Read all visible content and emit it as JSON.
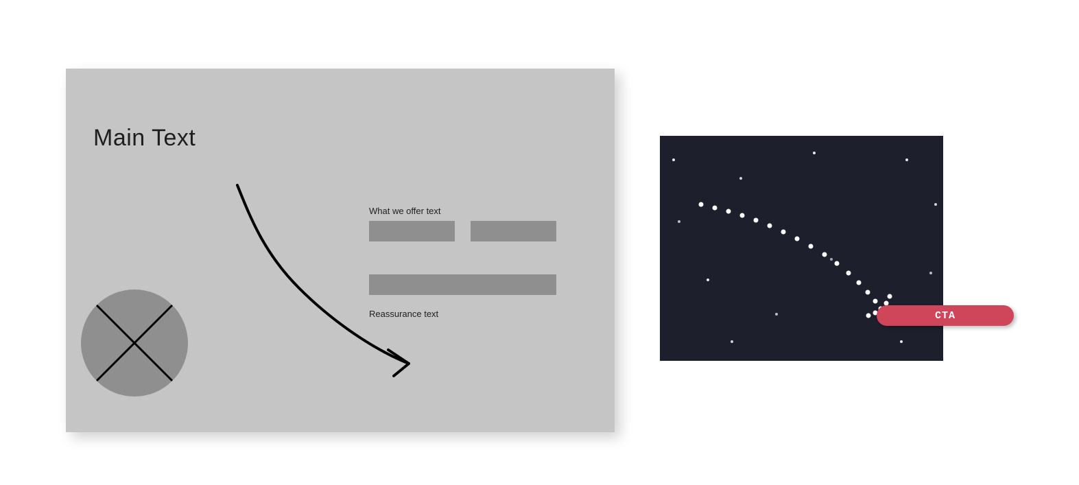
{
  "wireframe": {
    "main_text": "Main Text",
    "offer_text": "What we offer text",
    "reassurance_text": "Reassurance text"
  },
  "cta": {
    "label": "CTA"
  },
  "colors": {
    "panel_bg": "#c5c5c5",
    "block_bg": "#8f8f8f",
    "dark_bg": "#1d1f2c",
    "cta_bg": "#cf4559",
    "cta_fg": "#ffffff"
  }
}
